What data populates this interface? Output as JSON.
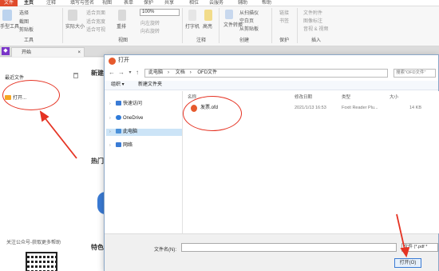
{
  "menu": {
    "file": "文件",
    "items": [
      "主页",
      "注释",
      "填写与签名",
      "视图",
      "表单",
      "保护",
      "共享",
      "相位",
      "云服务",
      "辅助",
      "帮助"
    ]
  },
  "ribbon": {
    "zoom": "100%",
    "labels": {
      "hand": "手型工具",
      "select": "选择",
      "snapshot": "截图",
      "clipboard": "剪贴板",
      "fit": "实际大小",
      "fit_page": "适合页面",
      "fit_width": "适合宽度",
      "fit_visible": "适合可视",
      "rotate_left": "向左旋转",
      "rotate_right": "向右旋转",
      "reflow": "重排",
      "tools_group": "工具",
      "view_group": "视图",
      "typewriter": "打字机",
      "highlight": "高亮",
      "comment_group": "注释",
      "file_convert": "文件转换",
      "from_scanner": "从扫描仪",
      "blank": "空白页",
      "from_clipboard": "从剪贴板",
      "create_group": "创建",
      "link": "链接",
      "bookmark": "书签",
      "protect_group": "保护",
      "file_attach": "文件附件",
      "image_annot": "图像标注",
      "audio_video": "音视 & 视频",
      "insert_group": "插入"
    }
  },
  "tabs": {
    "start": "开始"
  },
  "start_page": {
    "recent_title": "最近文件",
    "open_item": "打开...",
    "follow_text": "关注公众号-获取更多帮助",
    "section_new": "新建",
    "section_hot": "热门",
    "section_feature": "特色"
  },
  "dialog": {
    "title": "打开",
    "address": [
      "此电脑",
      "文档",
      "OFD文件"
    ],
    "search_placeholder": "搜索\"OFD文件\"",
    "toolbar": {
      "organize": "组织 ▾",
      "new_folder": "新建文件夹"
    },
    "nav": [
      {
        "label": "快速访问",
        "icon_color": "#3a7bd5"
      },
      {
        "label": "OneDrive",
        "icon_color": "#2f7bd9"
      },
      {
        "label": "此电脑",
        "icon_color": "#4a90d9",
        "selected": true
      },
      {
        "label": "网络",
        "icon_color": "#3a7bd5"
      }
    ],
    "columns": {
      "name": "名称",
      "date": "修改日期",
      "type": "类型",
      "size": "大小"
    },
    "files": [
      {
        "name": "发票.ofd",
        "date": "2021/1/13 16:53",
        "type": "Foxit Reader Plu...",
        "size": "14 KB"
      }
    ],
    "filename_label": "文件名(N):",
    "filename_value": "",
    "file_type": "文件 (*.pdf *",
    "open_button": "打开(O)"
  }
}
